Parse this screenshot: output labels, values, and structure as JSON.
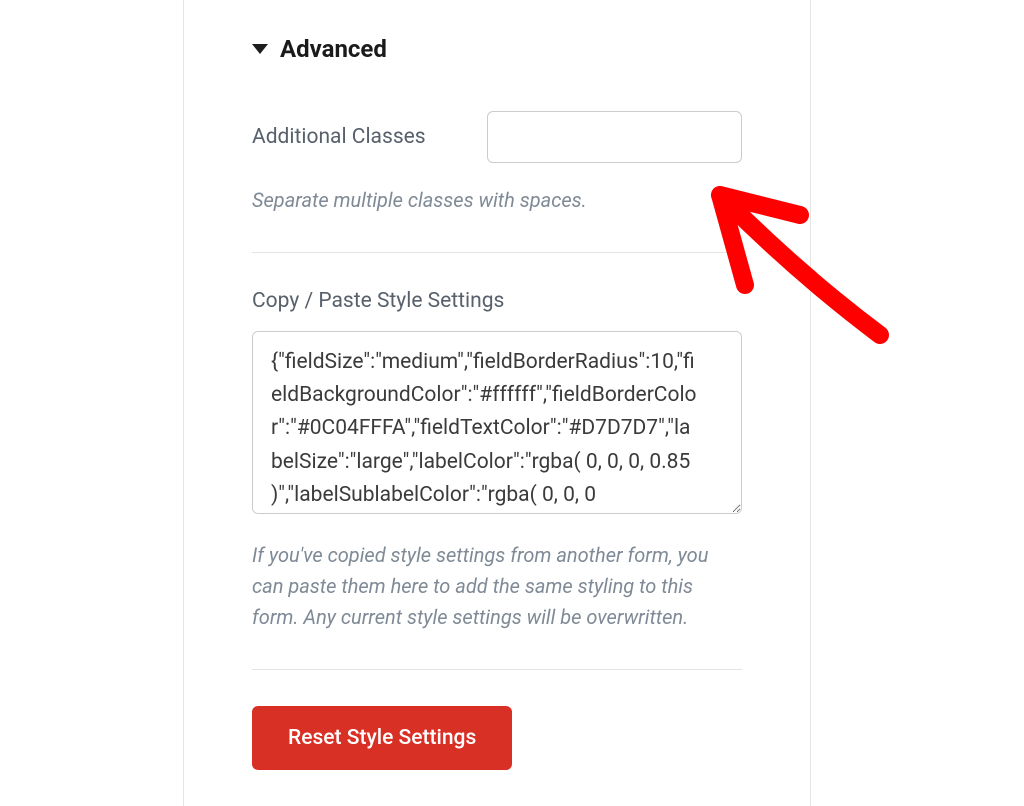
{
  "accordion": {
    "title": "Advanced"
  },
  "additionalClasses": {
    "label": "Additional Classes",
    "value": "",
    "help": "Separate multiple classes with spaces."
  },
  "styleSettings": {
    "label": "Copy / Paste Style Settings",
    "value": "{\"fieldSize\":\"medium\",\"fieldBorderRadius\":10,\"fieldBackgroundColor\":\"#ffffff\",\"fieldBorderColor\":\"#0C04FFFA\",\"fieldTextColor\":\"#D7D7D7\",\"labelSize\":\"large\",\"labelColor\":\"rgba( 0, 0, 0, 0.85 )\",\"labelSublabelColor\":\"rgba( 0, 0, 0",
    "help": "If you've copied style settings from another form, you can paste them here to add the same styling to this form. Any current style settings will be overwritten."
  },
  "resetButton": {
    "label": "Reset Style Settings"
  }
}
